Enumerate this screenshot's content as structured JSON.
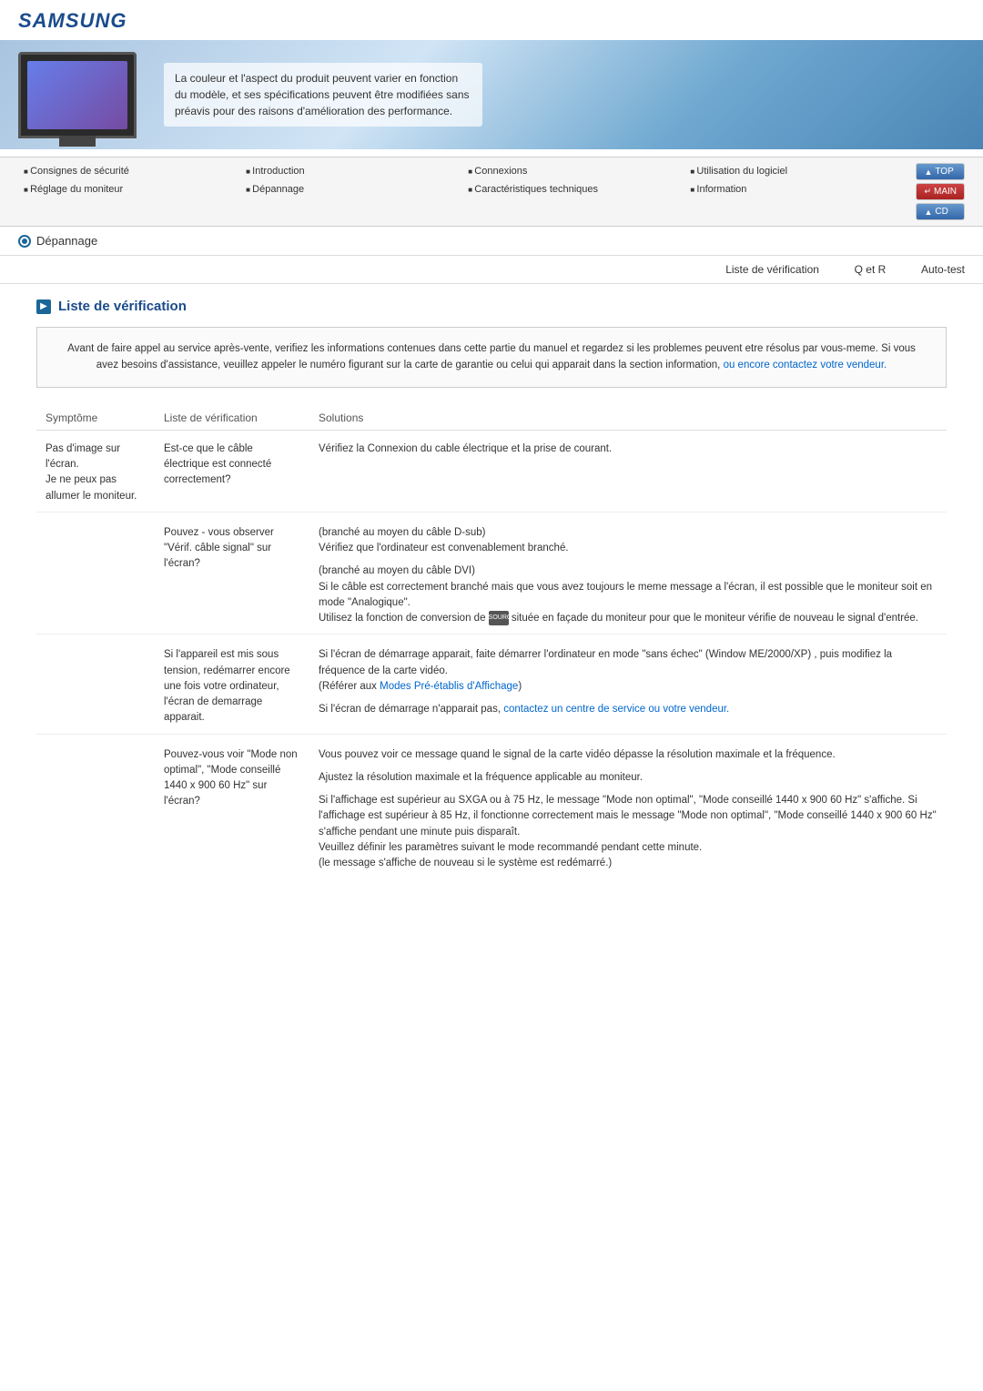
{
  "brand": "SAMSUNG",
  "banner": {
    "text": "La couleur et l'aspect du produit peuvent varier en fonction du modèle, et ses spécifications peuvent être modifiées sans préavis pour des raisons d'amélioration des performance."
  },
  "nav": {
    "row1": [
      {
        "label": "Consignes de sécurité"
      },
      {
        "label": "Introduction"
      },
      {
        "label": "Connexions"
      },
      {
        "label": "Utilisation du logiciel"
      }
    ],
    "row2": [
      {
        "label": "Réglage du moniteur"
      },
      {
        "label": "Dépannage"
      },
      {
        "label": "Caractéristiques techniques"
      },
      {
        "label": "Information"
      }
    ],
    "buttons": [
      {
        "label": "TOP"
      },
      {
        "label": "MAIN"
      },
      {
        "label": "CD"
      }
    ]
  },
  "breadcrumb": "Dépannage",
  "tabs": [
    "Liste de vérification",
    "Q et R",
    "Auto-test"
  ],
  "section": {
    "title": "Liste de vérification",
    "intro": "Avant de faire appel au service après-vente, verifiez les informations contenues dans cette partie du manuel et regardez si les problemes peuvent etre résolus par vous-meme. Si vous avez besoins d'assistance, veuillez appeler le numéro figurant sur la carte de garantie ou celui qui apparait dans la section information,",
    "intro_link": "ou encore contactez votre vendeur.",
    "table": {
      "headers": [
        "Symptôme",
        "Liste de vérification",
        "Solutions"
      ],
      "rows": [
        {
          "symptom": "Pas d'image sur l'écran.\nJe ne peux pas allumer le moniteur.",
          "check": "Est-ce que le câble électrique est connecté correctement?",
          "solution": "Vérifiez la Connexion du cable électrique et la prise de courant."
        },
        {
          "symptom": "",
          "check": "Pouvez - vous observer \"Vérif. câble signal\" sur l'écran?",
          "solution_parts": [
            {
              "text": "(branché au moyen du câble D-sub)\nVérifiez que l'ordinateur est convenablement branché."
            },
            {
              "text": "(branché au moyen du câble DVI)\nSi le câble est correctement branché mais que vous avez toujours le meme message a l'écran, il est possible que le moniteur soit en mode \"Analogique\".\nUtilisez la fonction de conversion de ",
              "icon": true,
              "icon_text": "SOURCE",
              "text2": " située en façade du moniteur pour que le moniteur vérifie de nouveau le signal d'entrée."
            }
          ]
        },
        {
          "symptom": "",
          "check": "Si l'appareil est mis sous tension, redémarrer encore une fois votre ordinateur, l'écran de demarrage apparait.",
          "solution_parts": [
            {
              "text": "Si l'écran de démarrage apparait, faite démarrer l'ordinateur en mode \"sans échec\" (Window ME/2000/XP) , puis modifiez la fréquence de la carte vidéo.\n(Référer aux ",
              "link": "Modes Pré-établis d'Affichage",
              "text2": ")"
            },
            {
              "text": "Si l'écran de démarrage n'apparait pas, ",
              "link": "contactez un centre de service ou votre vendeur.",
              "text2": ""
            }
          ]
        },
        {
          "symptom": "",
          "check": "Pouvez-vous voir \"Mode non optimal\", \"Mode conseillé 1440 x 900 60 Hz\" sur l'écran?",
          "solution_parts": [
            {
              "text": "Vous pouvez voir ce message quand le signal de la carte vidéo dépasse la résolution maximale et la fréquence."
            },
            {
              "text": "Ajustez la résolution maximale et la fréquence applicable au moniteur."
            },
            {
              "text": "Si l'affichage est supérieur au SXGA ou à 75 Hz, le message \"Mode non optimal\", \"Mode conseillé 1440 x 900 60 Hz\" s'affiche. Si l'affichage est supérieur à 85 Hz, il fonctionne correctement mais le message \"Mode non optimal\", \"Mode conseillé 1440 x 900 60 Hz\" s'affiche pendant une minute puis disparaît.\nVeuillez définir les paramètres suivant le mode recommandé pendant cette minute.\n(le message s'affiche de nouveau si le système est redémarré.)"
            }
          ]
        }
      ]
    }
  }
}
